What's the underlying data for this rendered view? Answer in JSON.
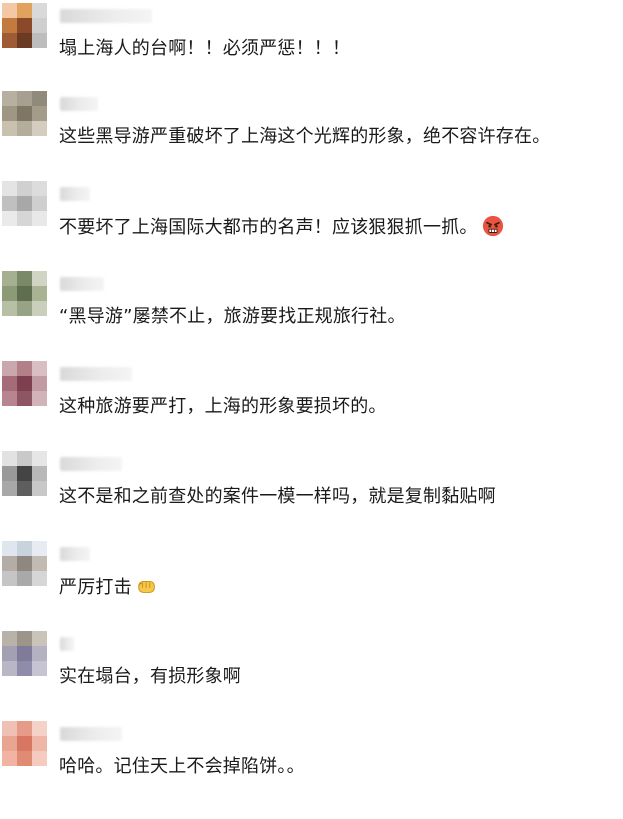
{
  "comments": [
    {
      "text": "塌上海人的台啊！！必须严惩！！！",
      "avatar": [
        "#f2c9a4",
        "#e0a25c",
        "#d9d9d9",
        "#c27a3e",
        "#8a4a2a",
        "#cfcfcf",
        "#9e5b36",
        "#6b3a22",
        "#bdbdbd"
      ]
    },
    {
      "text": "这些黑导游严重破坏了上海这个光辉的形象，绝不容许存在。",
      "avatar": [
        "#b7b0a0",
        "#a79f8f",
        "#8f8a7a",
        "#9f9684",
        "#7f7666",
        "#a49b88",
        "#c9c1b0",
        "#b5ad9c",
        "#d4cdbf"
      ]
    },
    {
      "text": "不要坏了上海国际大都市的名声！应该狠狠抓一抓。",
      "emoji": "angry-face-icon",
      "avatar": [
        "#e4e4e4",
        "#d0d0d0",
        "#dcdcdc",
        "#c0c0c0",
        "#a8a8a8",
        "#cfcfcf",
        "#eaeaea",
        "#d6d6d6",
        "#e8e8e8"
      ]
    },
    {
      "text": "“黑导游”屡禁不止，旅游要找正规旅行社。",
      "avatar": [
        "#a4b08f",
        "#7a8a68",
        "#cfd4c3",
        "#8c9a76",
        "#5f6e4e",
        "#a9b394",
        "#b7c0a4",
        "#97a384",
        "#c9cfbb"
      ]
    },
    {
      "text": "这种旅游要严打，上海的形象要损坏的。",
      "avatar": [
        "#c9a7ad",
        "#b28089",
        "#d9bfc4",
        "#a66b78",
        "#7e3f4f",
        "#c29aa3",
        "#b7848f",
        "#8e5564",
        "#d2b3b9"
      ]
    },
    {
      "text": "这不是和之前查处的案件一模一样吗，就是复制黏贴啊",
      "avatar": [
        "#e2e2e2",
        "#c9c9c9",
        "#e6e6e6",
        "#9a9a9a",
        "#444444",
        "#b8b8b8",
        "#a8a8a8",
        "#5e5e5e",
        "#c8c8c8"
      ]
    },
    {
      "text": "严厉打击",
      "emoji": "fist-icon",
      "avatar": [
        "#dfe6ee",
        "#c9d3de",
        "#e7ecf2",
        "#b3ada6",
        "#8f8881",
        "#c2bbb4",
        "#c5c5c5",
        "#a9a9a9",
        "#d6d6d6"
      ]
    },
    {
      "text": "实在塌台，有损形象啊",
      "avatar": [
        "#b8b2a8",
        "#9d958a",
        "#c9c3ba",
        "#a3a0b4",
        "#807b99",
        "#b4b1c3",
        "#b9b7c6",
        "#8e8bab",
        "#c6c4d2"
      ]
    },
    {
      "text": "哈哈。记住天上不会掉陷饼。。",
      "avatar": [
        "#f0c0b4",
        "#e59b88",
        "#f5d2c8",
        "#e8a692",
        "#d77762",
        "#eeb6a6",
        "#f2b4a2",
        "#e08b74",
        "#f6cbbf"
      ]
    }
  ]
}
